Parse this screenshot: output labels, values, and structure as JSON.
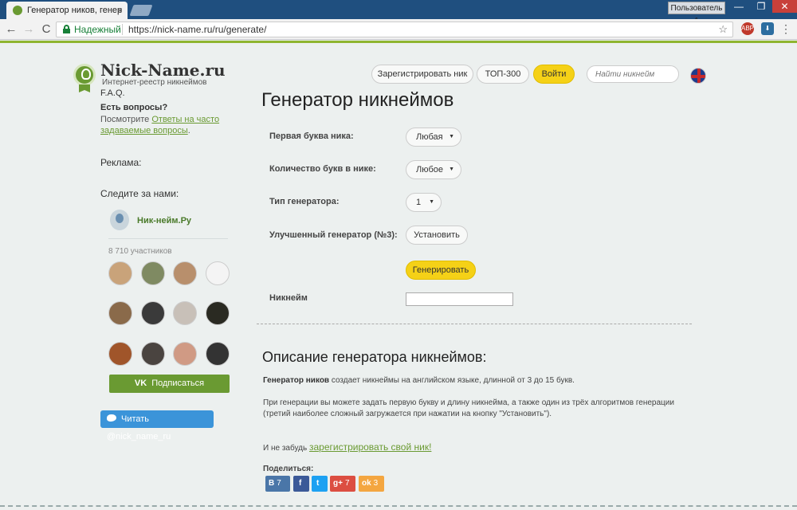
{
  "browser": {
    "tab_title": "Генератор ников, генер",
    "tab_close": "×",
    "user_button": "Пользователь 1",
    "win_min": "—",
    "win_max": "❐",
    "win_close": "✕",
    "nav_back": "←",
    "nav_forward": "→",
    "reload": "C",
    "secure_label": "Надежный",
    "url": "https://nick-name.ru/ru/generate/",
    "bookmark": "☆",
    "ext_abp": "ABP",
    "ext_dl": "⬇",
    "menu": "⋮",
    "colors": {
      "tabbar": "#1f4f7f",
      "secure": "#188038"
    }
  },
  "site": {
    "logo_title": "Nick-Name.ru",
    "logo_subtitle": "Интернет-реестр никнеймов",
    "faq": "F.A.Q.",
    "questions_title": "Есть вопросы?",
    "questions_prefix": "Посмотрите ",
    "questions_link": "Ответы на часто задаваемые вопросы",
    "questions_suffix": ".",
    "ads": "Реклама:",
    "follow": "Следите за нами:",
    "vk_group": "Ник-нейм.Ру",
    "vk_members": "8 710 участников",
    "vk_logo": "VK",
    "vk_subscribe": "Подписаться",
    "twitter": "Читать @nick_name_ru",
    "accent_color": "#6a9a32",
    "yellow_color": "#f5d117"
  },
  "nav": {
    "register": "Зарегистрировать ник",
    "top": "ТОП-300",
    "login": "Войти",
    "search_placeholder": "Найти никнейм"
  },
  "generator": {
    "title": "Генератор никнеймов",
    "first_letter_label": "Первая буква ника:",
    "first_letter_value": "Любая",
    "count_label": "Количество букв в нике:",
    "count_value": "Любое",
    "type_label": "Тип генератора:",
    "type_value": "1",
    "advanced_label": "Улучшенный генератор (№3):",
    "install_button": "Установить",
    "generate_button": "Генерировать",
    "nick_label": "Никнейм",
    "nick_value": "",
    "arrow": "▼"
  },
  "description": {
    "title": "Описание генератора никнеймов:",
    "p1_bold": "Генератор ников",
    "p1_rest": " создает никнеймы на английском языке, длинной от 3 до 15 букв.",
    "p2": "При генерации вы можете задать первую букву и длину никнейма, а также один из трёх алгоритмов генерации (третий наиболее сложный загружается при нажатии на кнопку \"Установить\").",
    "register_prefix": "И не забудь ",
    "register_link": "зарегистрировать свой ник!",
    "share_label": "Поделиться:",
    "share": [
      {
        "icon": "В",
        "count": "7",
        "color": "#4a76a8"
      },
      {
        "icon": "f",
        "count": "",
        "color": "#3b5998"
      },
      {
        "icon": "t",
        "count": "",
        "color": "#1da1f2"
      },
      {
        "icon": "g+",
        "count": "7",
        "color": "#dc4e41"
      },
      {
        "icon": "ok",
        "count": "3",
        "color": "#f4a640"
      }
    ]
  }
}
